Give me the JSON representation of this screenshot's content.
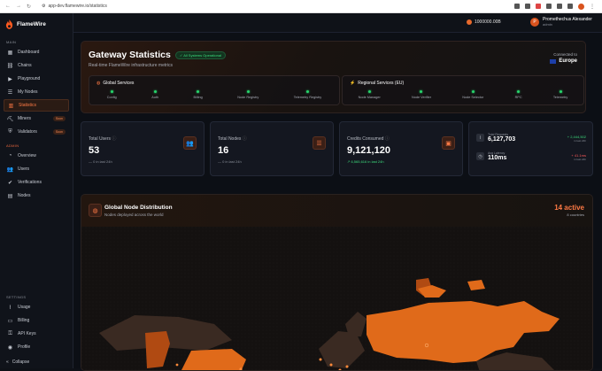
{
  "browser": {
    "url": "app-dev.flamewire.io/statistics"
  },
  "app": {
    "name": "FlameWire"
  },
  "sidebar": {
    "main_label": "MAIN",
    "main_items": [
      {
        "label": "Dashboard",
        "icon": "grid-icon"
      },
      {
        "label": "Chains",
        "icon": "link-icon"
      },
      {
        "label": "Playground",
        "icon": "play-icon"
      },
      {
        "label": "My Nodes",
        "icon": "server-icon"
      },
      {
        "label": "Statistics",
        "icon": "chart-icon",
        "active": true
      },
      {
        "label": "Miners",
        "icon": "miner-icon",
        "badge": "Soon"
      },
      {
        "label": "Validators",
        "icon": "shield-icon",
        "badge": "Soon"
      }
    ],
    "admin_label": "ADMIN",
    "admin_items": [
      {
        "label": "Overview",
        "icon": "gauge-icon"
      },
      {
        "label": "Users",
        "icon": "users-icon"
      },
      {
        "label": "Verifications",
        "icon": "check-icon"
      },
      {
        "label": "Nodes",
        "icon": "node-icon"
      }
    ],
    "settings_label": "SETTINGS",
    "settings_items": [
      {
        "label": "Usage",
        "icon": "activity-icon"
      },
      {
        "label": "Billing",
        "icon": "card-icon"
      },
      {
        "label": "API Keys",
        "icon": "key-icon"
      },
      {
        "label": "Profile",
        "icon": "user-icon"
      }
    ],
    "collapse_label": "Collapse"
  },
  "topbar": {
    "credits": "1000000.00B",
    "user_name": "Promethechus Alexander",
    "user_role": "admin",
    "avatar_letter": "P"
  },
  "hero": {
    "title": "Gateway Statistics",
    "status_badge": "All Systems Operational",
    "subtitle": "Real-time FlameWire infrastructure metrics",
    "connected_label": "Connected to",
    "connected_region": "Europe"
  },
  "global_services": {
    "title": "Global Services",
    "items": [
      "Config",
      "Auth",
      "Billing",
      "Node Registry",
      "Telemetry Registry"
    ]
  },
  "regional_services": {
    "title": "Regional Services (EU)",
    "items": [
      "Node Manager",
      "Node Verifier",
      "Node Selector",
      "RPC",
      "Telemetry"
    ]
  },
  "stats": {
    "users": {
      "label": "Total Users",
      "value": "53",
      "delta": "— 0 in last 24h"
    },
    "nodes": {
      "label": "Total Nodes",
      "value": "16",
      "delta": "— 0 in last 24h"
    },
    "credits": {
      "label": "Credits Consumed",
      "value": "9,121,120",
      "delta": "↗ 6,565,616 in last 24h"
    },
    "requests": {
      "label": "Total Requests",
      "value": "6,127,703",
      "delta": "+ 2,444,502",
      "delta_sub": "in last 24h"
    },
    "latency": {
      "label": "Avg Latency",
      "value": "110ms",
      "delta": "+ 41.1ms",
      "delta_sub": "in last 24h"
    }
  },
  "map": {
    "title": "Global Node Distribution",
    "subtitle": "Nodes deployed across the world",
    "active": "14 active",
    "countries": "8 countries"
  },
  "colors": {
    "accent": "#ff7a45",
    "ok": "#27d36b",
    "background": "#0c0f15"
  }
}
